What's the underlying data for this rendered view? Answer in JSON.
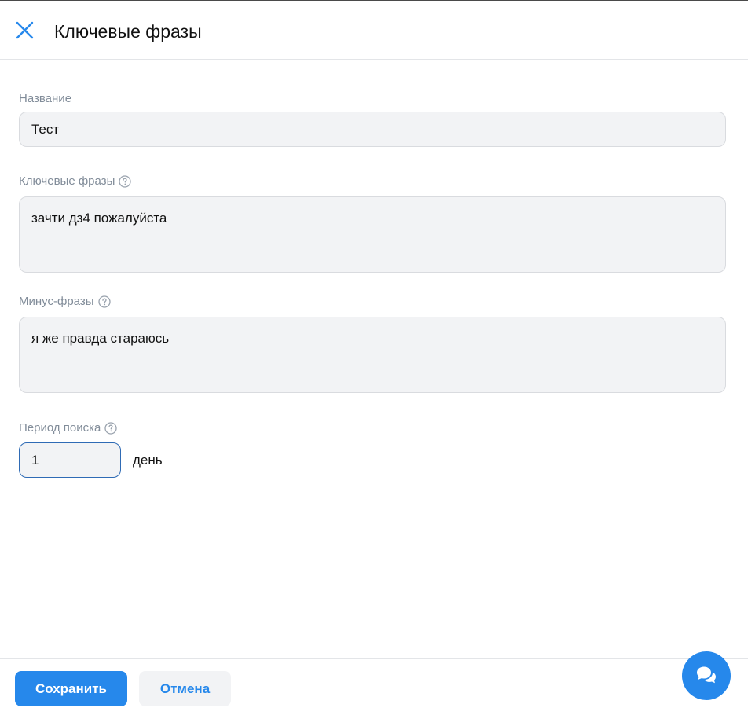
{
  "header": {
    "title": "Ключевые фразы",
    "close_icon": "close-icon"
  },
  "form": {
    "name": {
      "label": "Название",
      "value": "Тест"
    },
    "keywords": {
      "label": "Ключевые фразы",
      "help_icon": "question-circle-icon",
      "value": "зачти дз4 пожалуйста"
    },
    "minus_phrases": {
      "label": "Минус-фразы",
      "help_icon": "question-circle-icon",
      "value": "я же правда стараюсь"
    },
    "period": {
      "label": "Период поиска",
      "help_icon": "question-circle-icon",
      "value": "1",
      "unit": "день"
    }
  },
  "footer": {
    "save_label": "Сохранить",
    "cancel_label": "Отмена"
  },
  "chat_button": {
    "icon": "chat-bubbles-icon"
  },
  "colors": {
    "accent": "#2688eb",
    "field_bg": "#f2f3f5",
    "label": "#818c99",
    "focus_border": "#2f6bb5"
  }
}
